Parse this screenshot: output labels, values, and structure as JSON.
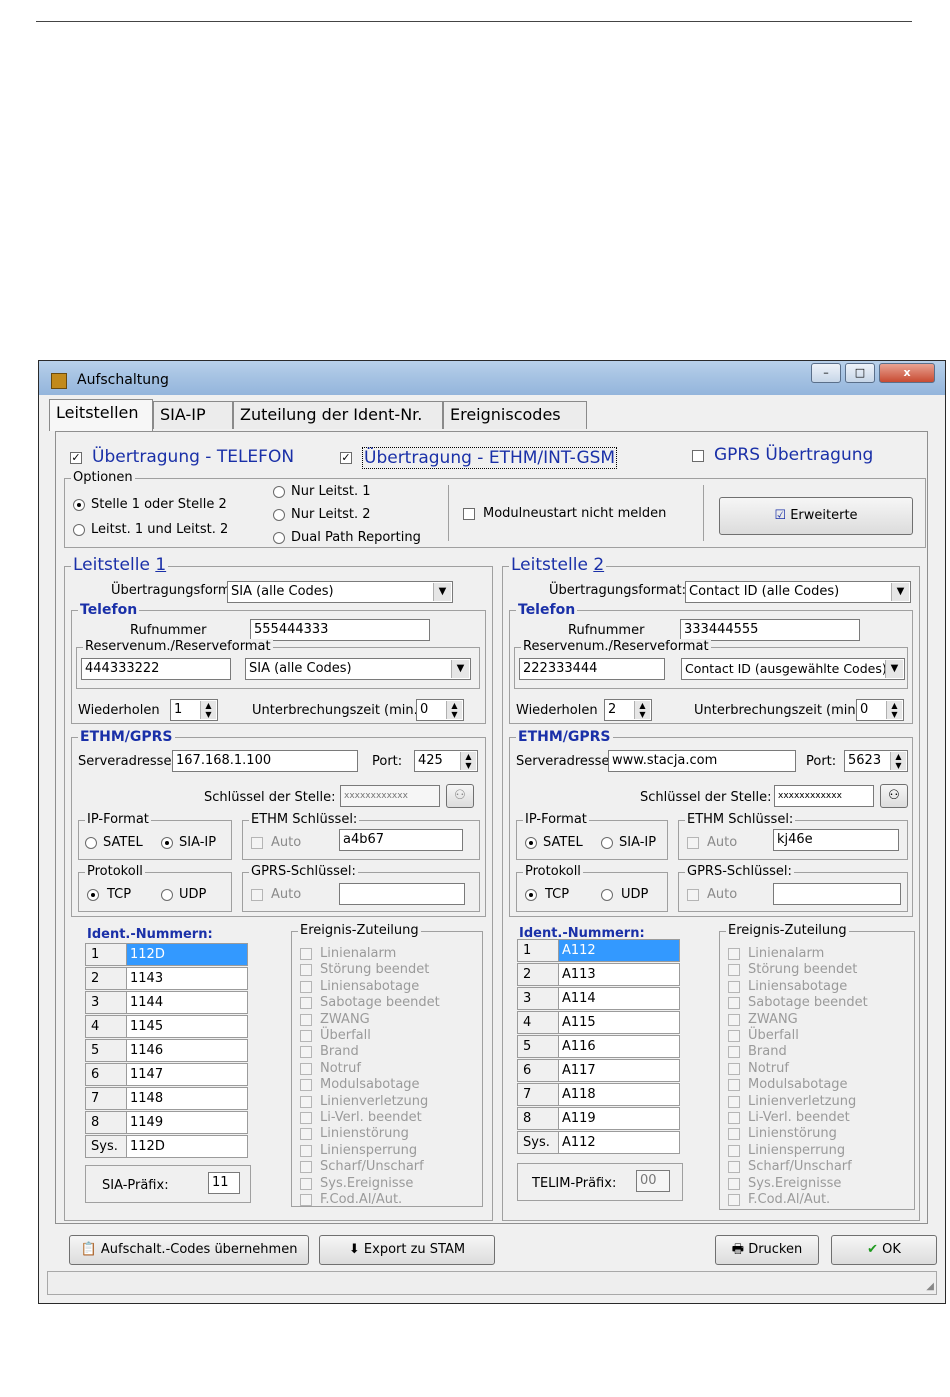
{
  "window": {
    "title": "Aufschaltung",
    "min": "–",
    "max": "□",
    "close": "x"
  },
  "tabs": [
    "Leitstellen",
    "SIA-IP",
    "Zuteilung der Ident-Nr.",
    "Ereigniscodes"
  ],
  "top": {
    "telefon_label": "Übertragung - TELEFON",
    "ethm_label": "Übertragung - ETHM/INT-GSM",
    "gprs_label": "GPRS Übertragung",
    "check_mark": "✓"
  },
  "optionen": {
    "legend": "Optionen",
    "radios": [
      "Stelle 1 oder Stelle 2",
      "Leitst. 1 und Leitst. 2",
      "Nur Leitst. 1",
      "Nur Leitst. 2",
      "Dual Path Reporting"
    ],
    "modulneustart": "Modulneustart nicht melden",
    "erweiterte": "Erweiterte"
  },
  "ls1": {
    "title": "Leitstelle ",
    "number": "1",
    "format_label": "Übertragungsformat",
    "format_value": "SIA (alle Codes)",
    "telefon_legend": "Telefon",
    "rufnummer_label": "Rufnummer",
    "rufnummer": "555444333",
    "reserve_legend": "Reservenum./Reserveformat",
    "reserve_num": "444333222",
    "reserve_format": "SIA (alle Codes)",
    "wiederholen_label": "Wiederholen",
    "wiederholen": "1",
    "unterbrechung_label": "Unterbrechungszeit (min.):",
    "unterbrechung": "0",
    "ethm_legend": "ETHM/GPRS",
    "server_label": "Serveradresse:",
    "server": "167.168.1.100",
    "port_label": "Port:",
    "port": "425",
    "schluessel_label": "Schlüssel der Stelle:",
    "schluessel": "xxxxxxxxxxxx",
    "ipformat_legend": "IP-Format",
    "satel": "SATEL",
    "siaip": "SIA-IP",
    "ethm_key_legend": "ETHM Schlüssel:",
    "auto": "Auto",
    "ethm_key": "a4b67",
    "protokoll_legend": "Protokoll",
    "tcp": "TCP",
    "udp": "UDP",
    "gprs_key_legend": "GPRS-Schlüssel:",
    "gprs_key": "",
    "ident_label": "Ident.-Nummern:",
    "ident": [
      {
        "n": "1",
        "v": "112D"
      },
      {
        "n": "2",
        "v": "1143"
      },
      {
        "n": "3",
        "v": "1144"
      },
      {
        "n": "4",
        "v": "1145"
      },
      {
        "n": "5",
        "v": "1146"
      },
      {
        "n": "6",
        "v": "1147"
      },
      {
        "n": "7",
        "v": "1148"
      },
      {
        "n": "8",
        "v": "1149"
      },
      {
        "n": "Sys.",
        "v": "112D"
      }
    ],
    "prefix_label": "SIA-Präfix:",
    "prefix": "11"
  },
  "ls2": {
    "title": "Leitstelle ",
    "number": "2",
    "format_label": "Übertragungsformat:",
    "format_value": "Contact ID (alle Codes)",
    "telefon_legend": "Telefon",
    "rufnummer_label": "Rufnummer",
    "rufnummer": "333444555",
    "reserve_legend": "Reservenum./Reserveformat",
    "reserve_num": "222333444",
    "reserve_format": "Contact ID (ausgewählte Codes)",
    "wiederholen_label": "Wiederholen",
    "wiederholen": "2",
    "unterbrechung_label": "Unterbrechungszeit (min.):",
    "unterbrechung": "0",
    "ethm_legend": "ETHM/GPRS",
    "server_label": "Serveradresse:",
    "server": "www.stacja.com",
    "port_label": "Port:",
    "port": "5623",
    "schluessel_label": "Schlüssel der Stelle:",
    "schluessel": "xxxxxxxxxxxx",
    "ipformat_legend": "IP-Format",
    "satel": "SATEL",
    "siaip": "SIA-IP",
    "ethm_key_legend": "ETHM Schlüssel:",
    "auto": "Auto",
    "ethm_key": "kj46e",
    "protokoll_legend": "Protokoll",
    "tcp": "TCP",
    "udp": "UDP",
    "gprs_key_legend": "GPRS-Schlüssel:",
    "gprs_key": "",
    "ident_label": "Ident.-Nummern:",
    "ident": [
      {
        "n": "1",
        "v": "A112"
      },
      {
        "n": "2",
        "v": "A113"
      },
      {
        "n": "3",
        "v": "A114"
      },
      {
        "n": "4",
        "v": "A115"
      },
      {
        "n": "5",
        "v": "A116"
      },
      {
        "n": "6",
        "v": "A117"
      },
      {
        "n": "7",
        "v": "A118"
      },
      {
        "n": "8",
        "v": "A119"
      },
      {
        "n": "Sys.",
        "v": "A112"
      }
    ],
    "prefix_label": "TELIM-Präfix:",
    "prefix": "00"
  },
  "events": {
    "legend": "Ereignis-Zuteilung",
    "items": [
      "Linienalarm",
      "Störung beendet",
      "Liniensabotage",
      "Sabotage beendet",
      "ZWANG",
      "Überfall",
      "Brand",
      "Notruf",
      "Modulsabotage",
      "Linienverletzung",
      "Li-Verl. beendet",
      "Linienstörung",
      "Liniensperrung",
      "Scharf/Unscharf",
      "Sys.Ereignisse",
      "F.Cod.Al/Aut."
    ]
  },
  "bottom": {
    "aufschalt": "Aufschalt.-Codes übernehmen",
    "export": "Export zu STAM",
    "drucken": "Drucken",
    "ok": "OK"
  },
  "colors": {
    "selection": "#3399ff",
    "accent": "#1a30a8"
  }
}
